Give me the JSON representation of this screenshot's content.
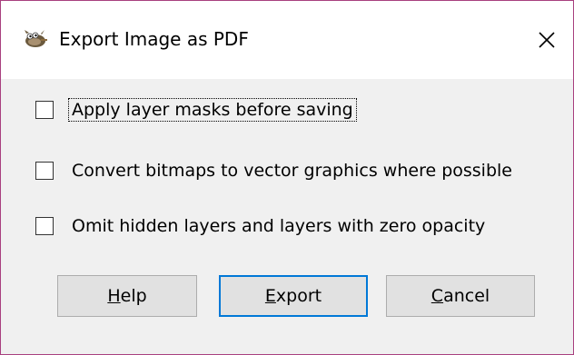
{
  "window": {
    "title": "Export Image as PDF",
    "icon": "gimp-wilber-icon",
    "close_icon": "close-icon",
    "accent_border": "#a8407f"
  },
  "options": [
    {
      "label": "Apply layer masks before saving",
      "checked": false,
      "focused": true
    },
    {
      "label": "Convert bitmaps to vector graphics where possible",
      "checked": false,
      "focused": false
    },
    {
      "label": "Omit hidden layers and layers with zero opacity",
      "checked": false,
      "focused": false
    }
  ],
  "buttons": {
    "help": {
      "mnemonic": "H",
      "rest": "elp"
    },
    "export": {
      "mnemonic": "E",
      "rest": "xport",
      "default": true
    },
    "cancel": {
      "mnemonic": "C",
      "rest": "ancel"
    }
  },
  "colors": {
    "default_button_border": "#0078d7",
    "button_bg": "#e1e1e1",
    "dialog_bg": "#f0f0f0"
  }
}
